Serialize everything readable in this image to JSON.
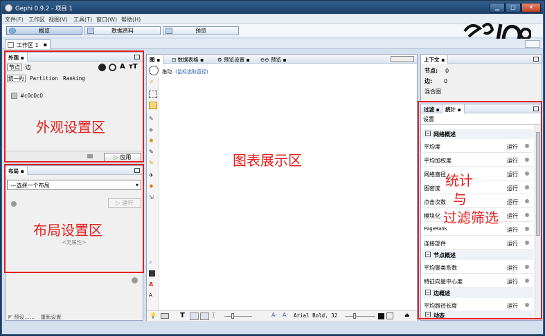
{
  "window": {
    "title": "Gephi 0.9.2 - 项目 1"
  },
  "menu": [
    "文件(F)",
    "工作区",
    "视图(V)",
    "工具(T)",
    "窗口(W)",
    "帮助(H)"
  ],
  "modes": [
    {
      "label": "概览"
    },
    {
      "label": "数据资料"
    },
    {
      "label": "预览"
    }
  ],
  "workspace_tab": "工作区 1",
  "appearance": {
    "tab": "外观",
    "node_tab": "节点",
    "edge_tab": "边",
    "mode_unique": "统一的",
    "mode_partition": "Partition",
    "mode_ranking": "Ranking",
    "color_value": "#c0c0c0",
    "apply_label": "应用",
    "annotation": "外观设置区"
  },
  "layout": {
    "tab": "布局",
    "select_placeholder": "---选择一个布局",
    "run_label": "运行",
    "no_properties": "<无属性>",
    "presets_label": "预设……",
    "reset_label": "重新设置",
    "annotation": "布局设置区"
  },
  "graph": {
    "tabs": [
      "图",
      "数据表格",
      "预览设置",
      "预览"
    ],
    "drag_label": "拖动",
    "drag_hint": "(鼠标选取直径)",
    "font_label": "Arial Bold, 32",
    "annotation": "图表展示区"
  },
  "context": {
    "tab": "上下文",
    "nodes_label": "节点:",
    "nodes_value": "0",
    "edges_label": "边:",
    "edges_value": "0",
    "graph_type": "混合图"
  },
  "stats": {
    "tab_filter": "过滤",
    "tab_stats": "统计",
    "settings_label": "设置",
    "sections": [
      {
        "title": "网络概述",
        "rows": [
          {
            "label": "平均度",
            "action": "运行"
          },
          {
            "label": "平均加权度",
            "action": "运行"
          },
          {
            "label": "网络直径",
            "action": "运行"
          },
          {
            "label": "图密度",
            "action": "运行"
          },
          {
            "label": "点击次数",
            "action": "运行"
          },
          {
            "label": "模块化",
            "action": "运行"
          },
          {
            "label": "PageRank",
            "action": "运行"
          },
          {
            "label": "连接部件",
            "action": "运行"
          }
        ]
      },
      {
        "title": "节点概述",
        "rows": [
          {
            "label": "平均聚类系数",
            "action": "运行"
          },
          {
            "label": "特征向量中心度",
            "action": "运行"
          }
        ]
      },
      {
        "title": "边概述",
        "rows": [
          {
            "label": "平均路径长度",
            "action": "运行"
          }
        ]
      },
      {
        "title": "动态",
        "rows": []
      }
    ],
    "annotation_line1": "统计",
    "annotation_line2": "与",
    "annotation_line3": "过滤筛选"
  },
  "colors": {
    "annotation": "#e52020",
    "titlebar": "#2f5d8c"
  }
}
